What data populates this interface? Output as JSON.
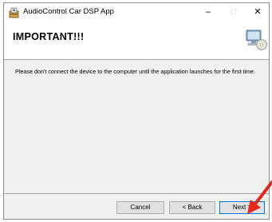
{
  "window": {
    "title": "AudioControl Car DSP App",
    "controls": {
      "minimize": "–",
      "maximize": "□",
      "close": "✕"
    }
  },
  "header": {
    "title": "IMPORTANT!!!",
    "icon": "computer-cd-icon"
  },
  "body": {
    "message": "Please don't connect the device to the computer until the application launches for the first time."
  },
  "buttons": {
    "cancel": "Cancel",
    "back": "< Back",
    "next": "Next >"
  },
  "annotation": {
    "icon": "red-arrow-icon",
    "color": "#e8261c"
  }
}
